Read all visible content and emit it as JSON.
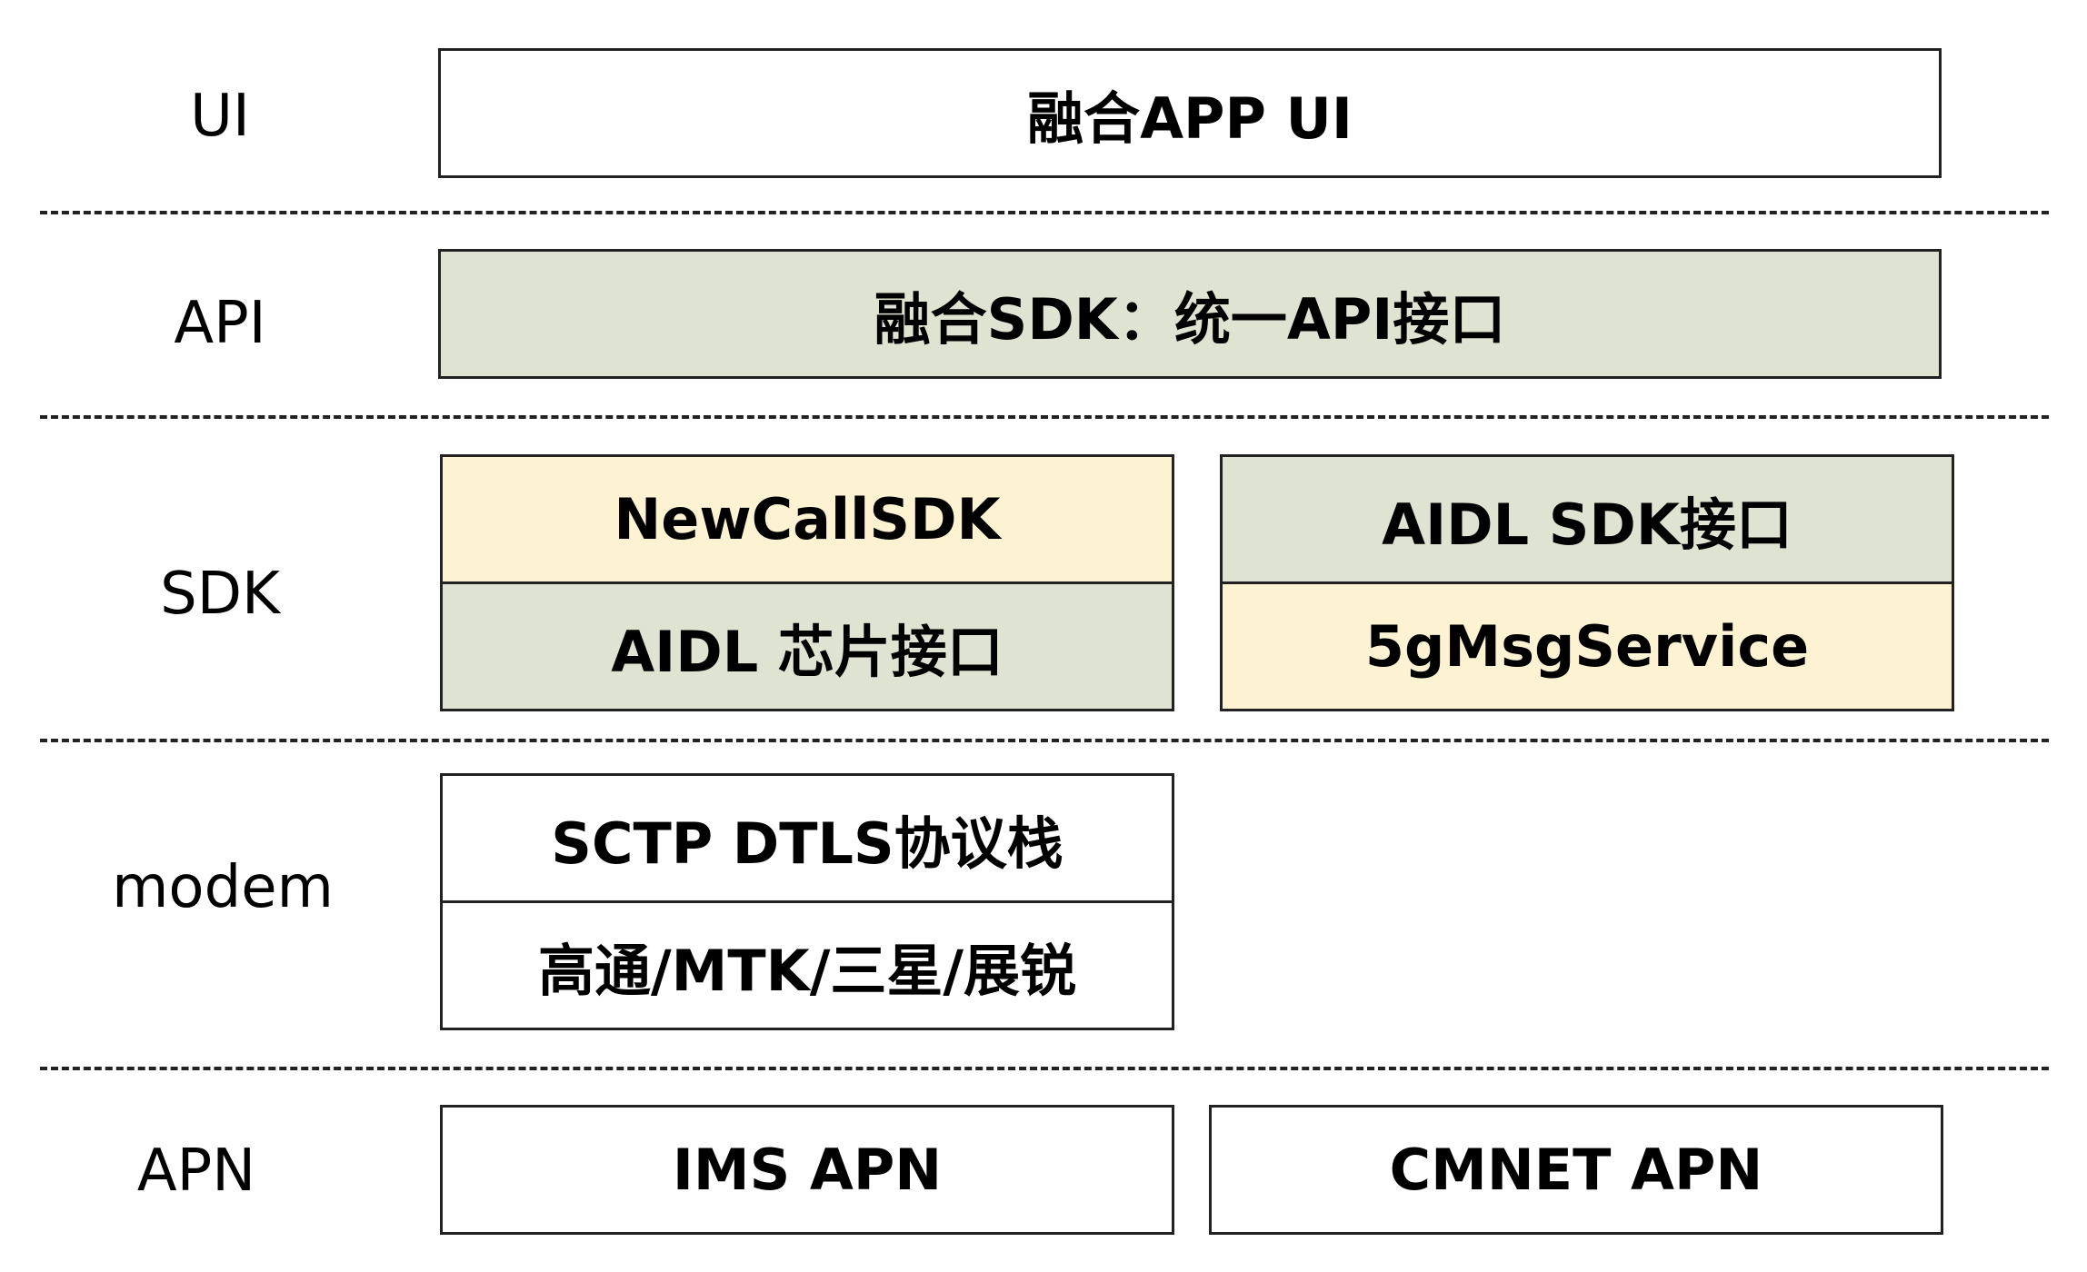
{
  "layers": {
    "ui": "UI",
    "api": "API",
    "sdk": "SDK",
    "modem": "modem",
    "apn": "APN"
  },
  "boxes": {
    "ui_app": "融合APP UI",
    "api_sdk": "融合SDK：统一API接口",
    "newcall_sdk": "NewCallSDK",
    "aidl_chip": "AIDL 芯片接口",
    "aidl_sdk": "AIDL SDK接口",
    "msg_service": "5gMsgService",
    "sctp_dtls": "SCTP DTLS协议栈",
    "chip_vendors": "高通/MTK/三星/展锐",
    "ims_apn": "IMS APN",
    "cmnet_apn": "CMNET APN"
  },
  "colors": {
    "green_fill": "#dfe3d1",
    "yellow_fill": "#fdf3d3",
    "white_fill": "#ffffff",
    "border": "#222222"
  }
}
